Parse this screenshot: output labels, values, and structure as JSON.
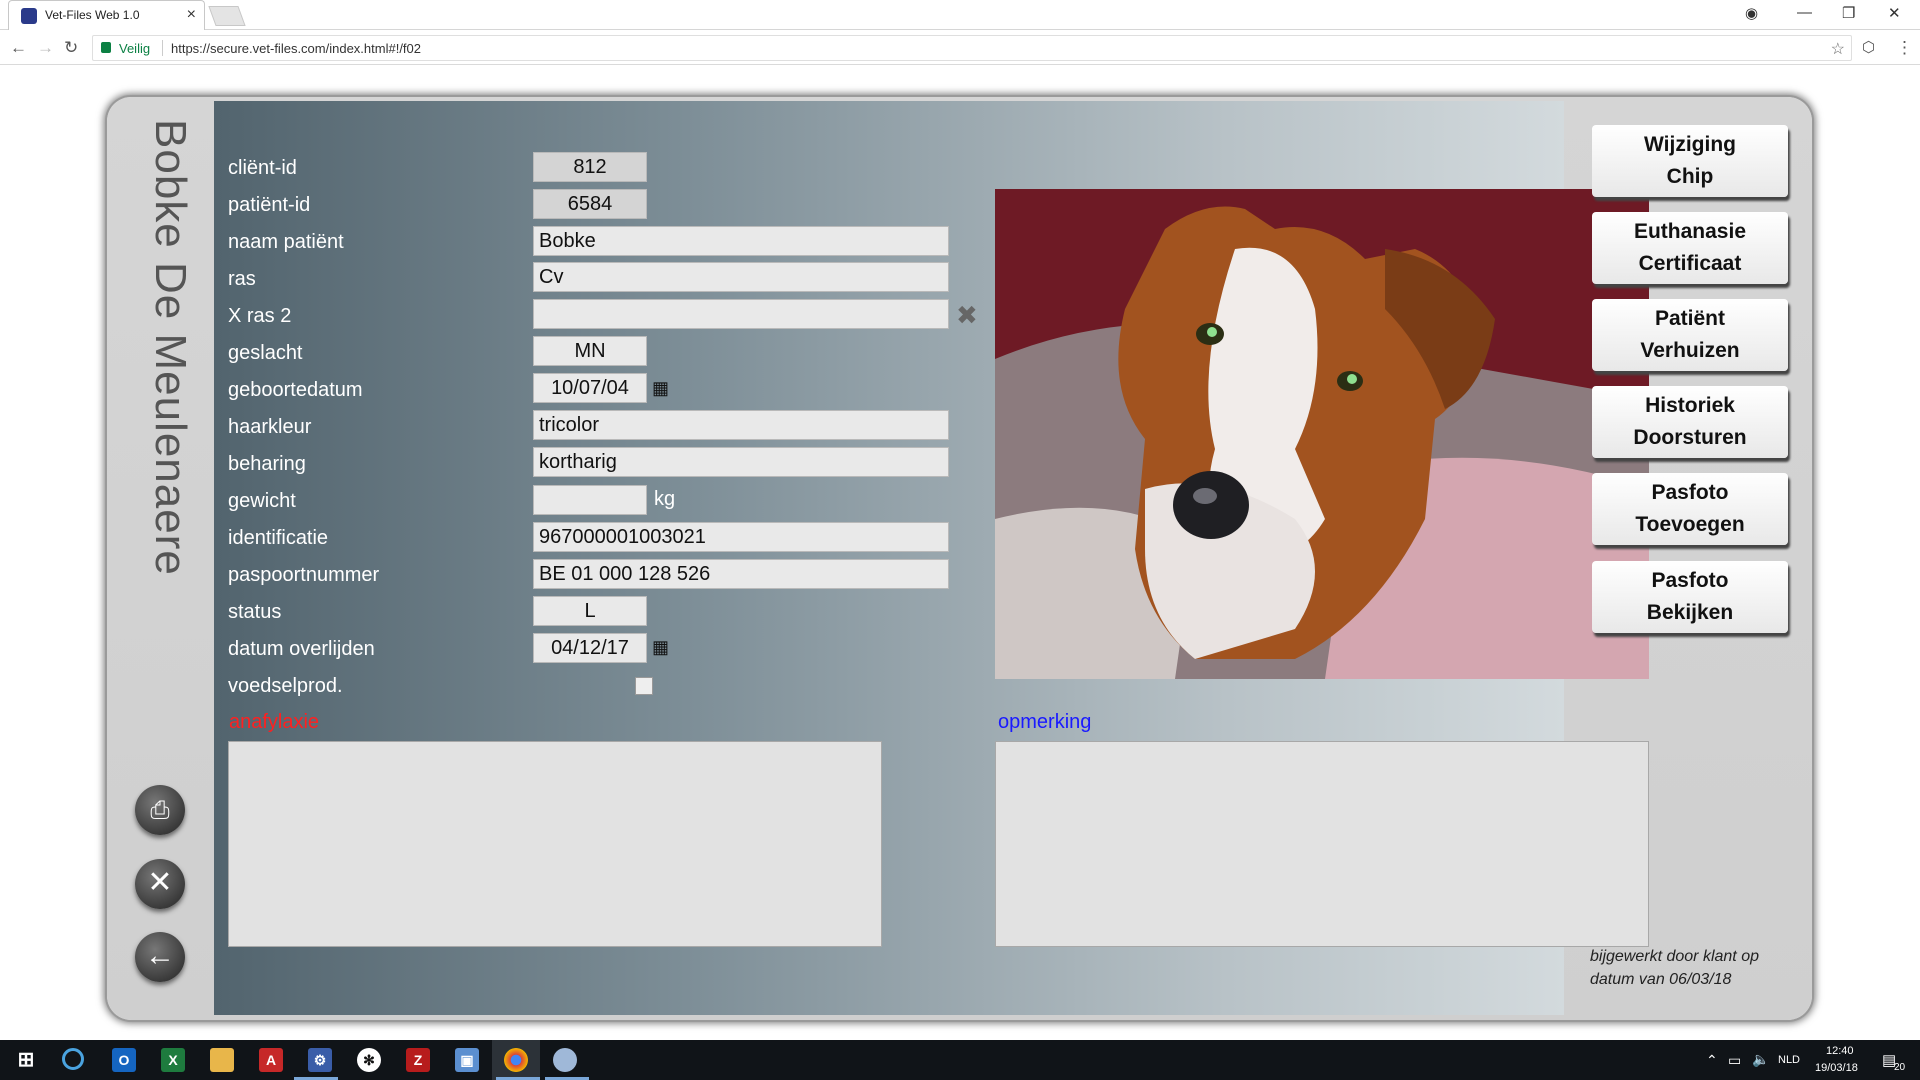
{
  "browser": {
    "tab_title": "Vet-Files Web 1.0",
    "secure_label": "Veilig",
    "url": "https://secure.vet-files.com/index.html#!/f02"
  },
  "patient_header": {
    "name": "Bobke De Meulenaere"
  },
  "form": {
    "client_id": {
      "label": "cliënt-id",
      "value": "812"
    },
    "patient_id": {
      "label": "patiënt-id",
      "value": "6584"
    },
    "patient_name": {
      "label": "naam patiënt",
      "value": "Bobke"
    },
    "breed": {
      "label": "ras",
      "value": "Cv"
    },
    "breed2": {
      "label": "X ras 2",
      "value": ""
    },
    "sex": {
      "label": "geslacht",
      "value": "MN"
    },
    "birthdate": {
      "label": "geboortedatum",
      "value": "10/07/04"
    },
    "hair_color": {
      "label": "haarkleur",
      "value": "tricolor"
    },
    "coat": {
      "label": "beharing",
      "value": "kortharig"
    },
    "weight": {
      "label": "gewicht",
      "value": "",
      "unit": "kg"
    },
    "identification": {
      "label": "identificatie",
      "value": "967000001003021"
    },
    "passport": {
      "label": "paspoortnummer",
      "value": "BE 01 000 128 526"
    },
    "status": {
      "label": "status",
      "value": "L"
    },
    "death_date": {
      "label": "datum overlijden",
      "value": "04/12/17"
    },
    "food_prod": {
      "label": "voedselprod.",
      "checked": false
    }
  },
  "notes": {
    "anaphylaxis_label": "anafylaxie",
    "remark_label": "opmerking"
  },
  "side_buttons": [
    {
      "line1": "Wijziging",
      "line2": "Chip"
    },
    {
      "line1": "Euthanasie",
      "line2": "Certificaat"
    },
    {
      "line1": "Patiënt",
      "line2": "Verhuizen"
    },
    {
      "line1": "Historiek",
      "line2": "Doorsturen"
    },
    {
      "line1": "Pasfoto",
      "line2": "Toevoegen"
    },
    {
      "line1": "Pasfoto",
      "line2": "Bekijken"
    }
  ],
  "updated_note": "bijgewerkt door klant op datum van 06/03/18",
  "taskbar": {
    "language": "NLD",
    "time": "12:40",
    "date": "19/03/18",
    "notifications": "20"
  },
  "colors": {
    "anaphylaxis": "#ff2020",
    "remark": "#1a1aff"
  }
}
